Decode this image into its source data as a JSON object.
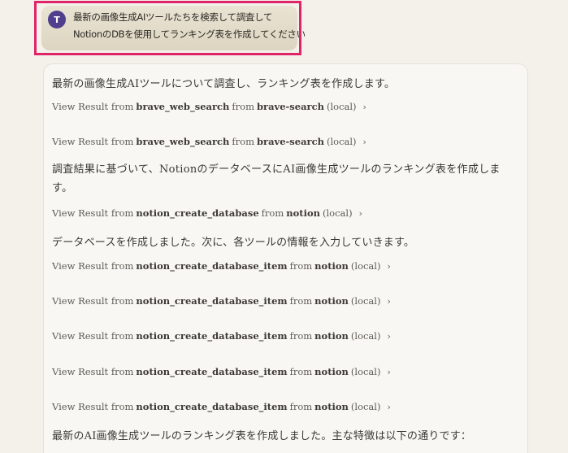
{
  "user_message": {
    "avatar_initial": "T",
    "line1": "最新の画像生成AIツールたちを検索して調査して",
    "line2": "NotionのDBを使用してランキング表を作成してください"
  },
  "response": {
    "intro": "最新の画像生成AIツールについて調査し、ランキング表を作成します。",
    "tool_calls": [
      {
        "prefix": "View Result from",
        "tool": "brave_web_search",
        "mid": "from",
        "server": "brave-search",
        "suffix": "(local)"
      },
      {
        "prefix": "View Result from",
        "tool": "brave_web_search",
        "mid": "from",
        "server": "brave-search",
        "suffix": "(local)"
      },
      {
        "prefix": "View Result from",
        "tool": "notion_create_database",
        "mid": "from",
        "server": "notion",
        "suffix": "(local)"
      },
      {
        "prefix": "View Result from",
        "tool": "notion_create_database_item",
        "mid": "from",
        "server": "notion",
        "suffix": "(local)"
      },
      {
        "prefix": "View Result from",
        "tool": "notion_create_database_item",
        "mid": "from",
        "server": "notion",
        "suffix": "(local)"
      },
      {
        "prefix": "View Result from",
        "tool": "notion_create_database_item",
        "mid": "from",
        "server": "notion",
        "suffix": "(local)"
      },
      {
        "prefix": "View Result from",
        "tool": "notion_create_database_item",
        "mid": "from",
        "server": "notion",
        "suffix": "(local)"
      },
      {
        "prefix": "View Result from",
        "tool": "notion_create_database_item",
        "mid": "from",
        "server": "notion",
        "suffix": "(local)"
      }
    ],
    "para_after_search": "調査結果に基づいて、NotionのデータベースにAI画像生成ツールのランキング表を作成します。",
    "para_after_db": "データベースを作成しました。次に、各ツールの情報を入力していきます。",
    "para_final": "最新のAI画像生成ツールのランキング表を作成しました。主な特徴は以下の通りです："
  },
  "colors": {
    "highlight": "#e0246a",
    "avatar_bg": "#4f3f8c",
    "bubble_bg": "#e4ddcb",
    "page_bg": "#f3f1ea"
  },
  "icons": {
    "chevron": "chevron-right-icon"
  }
}
